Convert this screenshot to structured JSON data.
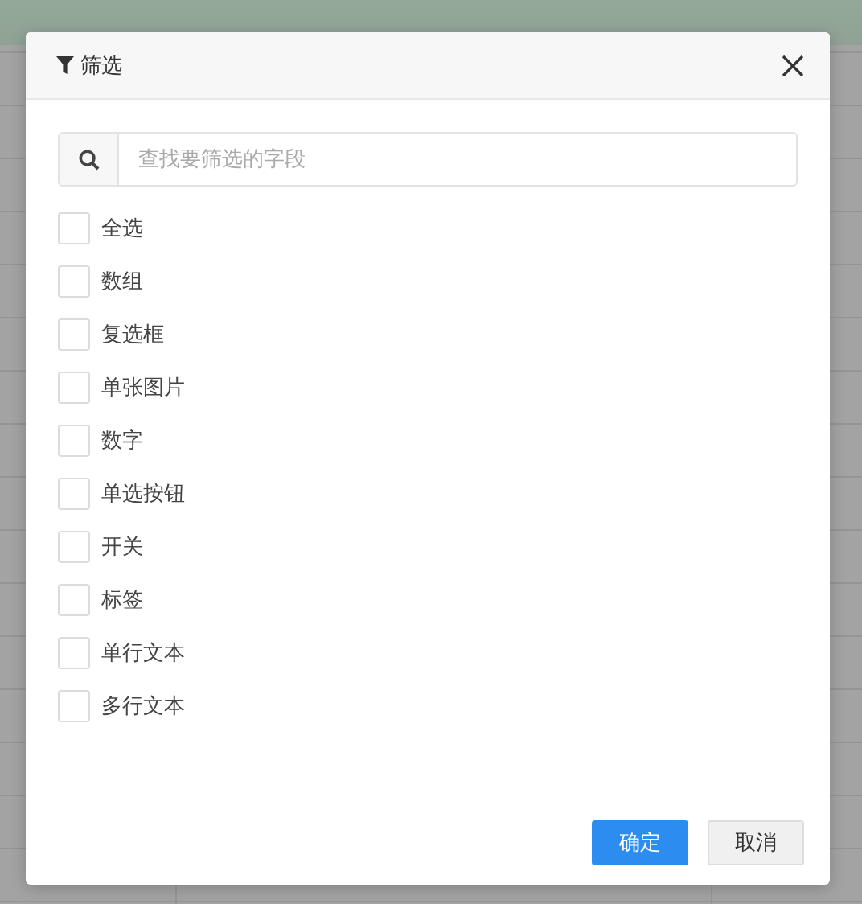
{
  "dialog": {
    "title": "筛选"
  },
  "search": {
    "placeholder": "查找要筛选的字段"
  },
  "options": [
    {
      "label": "全选",
      "checked": false
    },
    {
      "label": "数组",
      "checked": false
    },
    {
      "label": "复选框",
      "checked": false
    },
    {
      "label": "单张图片",
      "checked": false
    },
    {
      "label": "数字",
      "checked": false
    },
    {
      "label": "单选按钮",
      "checked": false
    },
    {
      "label": "开关",
      "checked": false
    },
    {
      "label": "标签",
      "checked": false
    },
    {
      "label": "单行文本",
      "checked": false
    },
    {
      "label": "多行文本",
      "checked": false
    }
  ],
  "buttons": [
    {
      "label": "确定",
      "kind": "primary"
    },
    {
      "label": "取消",
      "kind": "default"
    }
  ]
}
